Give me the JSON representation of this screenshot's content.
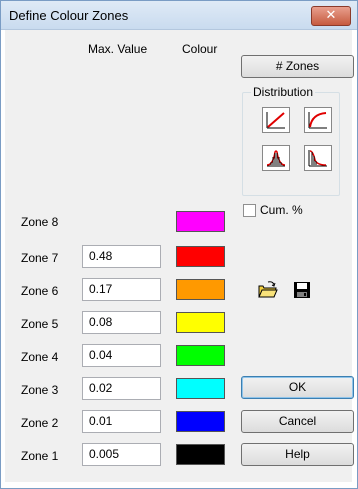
{
  "window": {
    "title": "Define Colour Zones",
    "close_glyph": "✕"
  },
  "headers": {
    "max_value": "Max. Value",
    "colour": "Colour"
  },
  "zones": [
    {
      "label": "Zone 8",
      "value": "",
      "color": "#ff00ff"
    },
    {
      "label": "Zone 7",
      "value": "0.48",
      "color": "#ff0000"
    },
    {
      "label": "Zone 6",
      "value": "0.17",
      "color": "#ff9900"
    },
    {
      "label": "Zone 5",
      "value": "0.08",
      "color": "#ffff00"
    },
    {
      "label": "Zone 4",
      "value": "0.04",
      "color": "#00ff00"
    },
    {
      "label": "Zone 3",
      "value": "0.02",
      "color": "#00ffff"
    },
    {
      "label": "Zone 2",
      "value": "0.01",
      "color": "#0000ff"
    },
    {
      "label": "Zone 1",
      "value": "0.005",
      "color": "#000000"
    }
  ],
  "buttons": {
    "zones": "# Zones",
    "ok": "OK",
    "cancel": "Cancel",
    "help": "Help"
  },
  "distribution": {
    "label": "Distribution",
    "icons": [
      "linear-distribution-icon",
      "curve-distribution-icon",
      "normal-distribution-icon",
      "cumulative-distribution-icon"
    ]
  },
  "cumulative": {
    "label": "Cum. %",
    "checked": false
  },
  "tools": {
    "open": "open-folder-icon",
    "save": "save-disk-icon"
  }
}
